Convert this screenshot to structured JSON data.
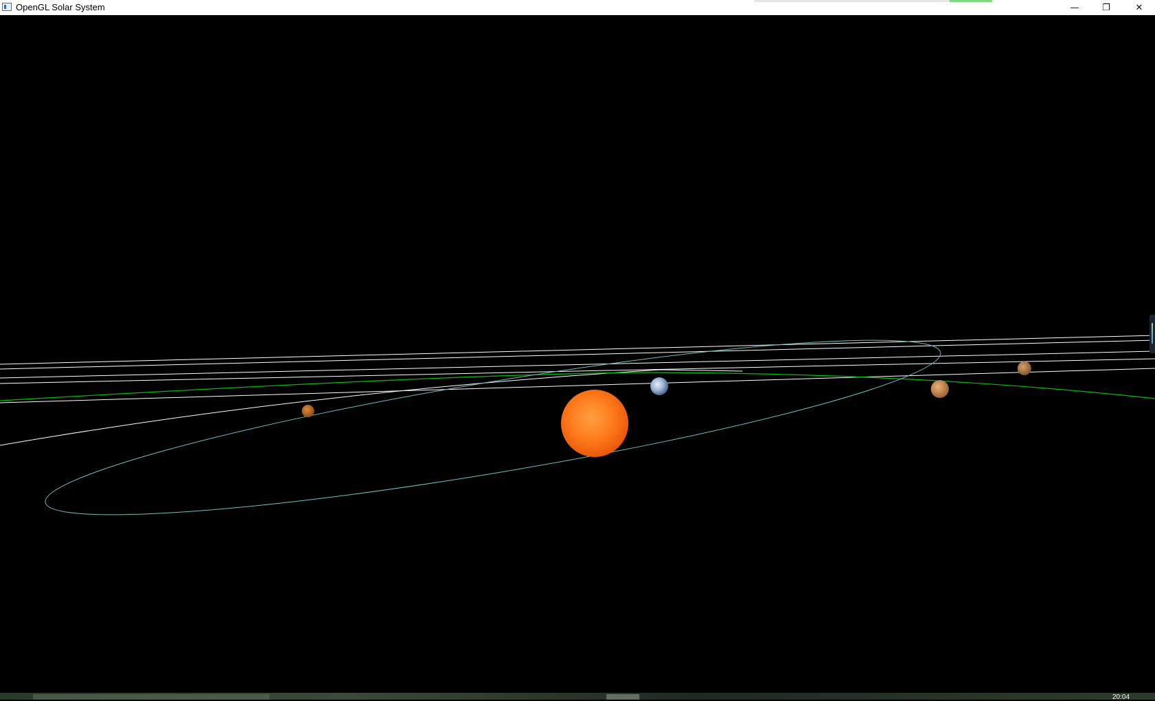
{
  "window": {
    "title": "OpenGL Solar System",
    "controls": {
      "minimize": "—",
      "maximize": "❐",
      "close": "✕"
    }
  },
  "scene": {
    "background_color": "#000000",
    "bodies": [
      {
        "name": "sun",
        "color": "#ff7a1a"
      },
      {
        "name": "earth",
        "color": "#9fb6d6"
      },
      {
        "name": "planet",
        "color": "#c9894a"
      },
      {
        "name": "planet",
        "color": "#b86a22"
      },
      {
        "name": "planet",
        "color": "#b07a46"
      }
    ],
    "orbit_colors": {
      "white": "#ffffff",
      "green": "#00c000",
      "teal": "#6fc3bb"
    }
  },
  "taskbar": {
    "clock": "20:04"
  }
}
